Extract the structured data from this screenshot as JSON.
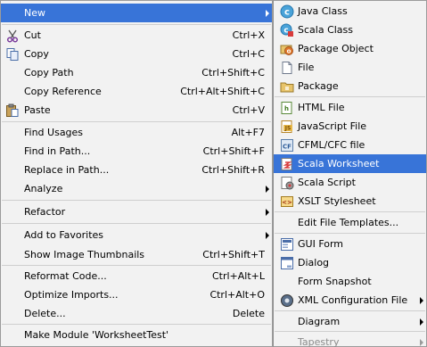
{
  "main_menu": {
    "new": {
      "label": "New"
    },
    "cut": {
      "label": "Cut",
      "shortcut": "Ctrl+X"
    },
    "copy": {
      "label": "Copy",
      "shortcut": "Ctrl+C"
    },
    "copy_path": {
      "label": "Copy Path",
      "shortcut": "Ctrl+Shift+C"
    },
    "copy_reference": {
      "label": "Copy Reference",
      "shortcut": "Ctrl+Alt+Shift+C"
    },
    "paste": {
      "label": "Paste",
      "shortcut": "Ctrl+V"
    },
    "find_usages": {
      "label": "Find Usages",
      "shortcut": "Alt+F7"
    },
    "find_in_path": {
      "label": "Find in Path...",
      "shortcut": "Ctrl+Shift+F"
    },
    "replace_in_path": {
      "label": "Replace in Path...",
      "shortcut": "Ctrl+Shift+R"
    },
    "analyze": {
      "label": "Analyze"
    },
    "refactor": {
      "label": "Refactor"
    },
    "add_to_favorites": {
      "label": "Add to Favorites"
    },
    "show_image_thumbnails": {
      "label": "Show Image Thumbnails",
      "shortcut": "Ctrl+Shift+T"
    },
    "reformat_code": {
      "label": "Reformat Code...",
      "shortcut": "Ctrl+Alt+L"
    },
    "optimize_imports": {
      "label": "Optimize Imports...",
      "shortcut": "Ctrl+Alt+O"
    },
    "delete": {
      "label": "Delete...",
      "shortcut": "Delete"
    },
    "make_module": {
      "label": "Make Module 'WorksheetTest'"
    }
  },
  "sub_menu": {
    "java_class": {
      "label": "Java Class"
    },
    "scala_class": {
      "label": "Scala Class"
    },
    "package_object": {
      "label": "Package Object"
    },
    "file": {
      "label": "File"
    },
    "package": {
      "label": "Package"
    },
    "html_file": {
      "label": "HTML File"
    },
    "javascript_file": {
      "label": "JavaScript File"
    },
    "cfml_cfc_file": {
      "label": "CFML/CFC file"
    },
    "scala_worksheet": {
      "label": "Scala Worksheet"
    },
    "scala_script": {
      "label": "Scala Script"
    },
    "xslt_stylesheet": {
      "label": "XSLT Stylesheet"
    },
    "edit_file_templates": {
      "label": "Edit File Templates..."
    },
    "gui_form": {
      "label": "GUI Form"
    },
    "dialog": {
      "label": "Dialog"
    },
    "form_snapshot": {
      "label": "Form Snapshot"
    },
    "xml_configuration_file": {
      "label": "XML Configuration File"
    },
    "diagram": {
      "label": "Diagram"
    },
    "tapestry": {
      "label": "Tapestry"
    }
  },
  "icons": {
    "cut": "scissors-icon",
    "copy": "copy-icon",
    "paste": "paste-icon",
    "java_class": "class-c-icon",
    "scala_class": "scala-class-icon",
    "package_object": "package-object-icon",
    "file": "file-icon",
    "package": "folder-icon",
    "html_file": "html-file-icon",
    "javascript_file": "javascript-file-icon",
    "cfml_cfc_file": "cf-file-icon",
    "scala_worksheet": "scala-worksheet-icon",
    "scala_script": "scala-script-icon",
    "xslt_stylesheet": "xslt-icon",
    "gui_form": "gui-form-icon",
    "dialog": "dialog-icon",
    "xml_configuration_file": "xml-config-icon"
  },
  "colors": {
    "menu_background": "#f2f2f2",
    "selection": "#3874d8",
    "disabled_text": "#8c8c8c"
  }
}
